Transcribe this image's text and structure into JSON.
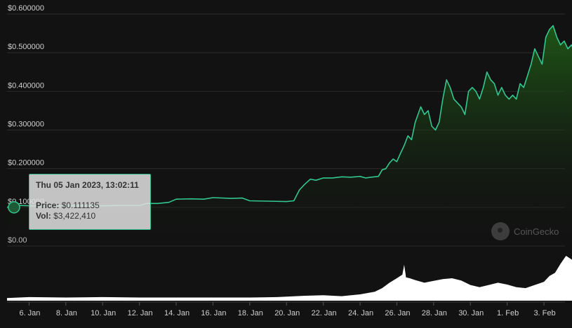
{
  "chart_data": {
    "type": "area",
    "y_ticks": [
      "$0.600000",
      "$0.500000",
      "$0.400000",
      "$0.300000",
      "$0.200000",
      "$0.100000",
      "$0.00"
    ],
    "x_ticks": [
      "6. Jan",
      "8. Jan",
      "10. Jan",
      "12. Jan",
      "14. Jan",
      "16. Jan",
      "18. Jan",
      "20. Jan",
      "22. Jan",
      "24. Jan",
      "26. Jan",
      "28. Jan",
      "30. Jan",
      "1. Feb",
      "3. Feb"
    ],
    "ylim": [
      0,
      0.6
    ],
    "xlim": [
      4.8,
      36.7
    ],
    "grid": "horizontal",
    "price_series": {
      "x": [
        4.8,
        5.4,
        6.0,
        7.0,
        8.0,
        9.0,
        10.0,
        11.0,
        12.0,
        12.4,
        13.0,
        13.6,
        14.0,
        14.8,
        15.5,
        16.0,
        17.0,
        17.6,
        18.0,
        19.0,
        20.0,
        20.4,
        20.7,
        21.0,
        21.3,
        21.6,
        22.0,
        22.5,
        23.0,
        23.5,
        24.0,
        24.3,
        24.6,
        25.0,
        25.2,
        25.4,
        25.6,
        25.8,
        26.0,
        26.2,
        26.4,
        26.6,
        26.8,
        27.0,
        27.3,
        27.5,
        27.7,
        27.9,
        28.1,
        28.3,
        28.5,
        28.7,
        28.9,
        29.1,
        29.3,
        29.5,
        29.7,
        29.9,
        30.1,
        30.3,
        30.5,
        30.7,
        30.9,
        31.1,
        31.3,
        31.5,
        31.7,
        31.9,
        32.1,
        32.3,
        32.5,
        32.7,
        32.9,
        33.1,
        33.3,
        33.5,
        33.7,
        33.9,
        34.1,
        34.3,
        34.5,
        34.7,
        34.9,
        35.1,
        35.3,
        35.5,
        35.7,
        35.9,
        36.1,
        36.3,
        36.5,
        36.7
      ],
      "y": [
        0.1,
        0.105,
        0.104,
        0.103,
        0.104,
        0.104,
        0.104,
        0.105,
        0.105,
        0.11,
        0.11,
        0.113,
        0.121,
        0.122,
        0.121,
        0.125,
        0.123,
        0.124,
        0.117,
        0.116,
        0.115,
        0.117,
        0.145,
        0.16,
        0.173,
        0.17,
        0.176,
        0.176,
        0.179,
        0.178,
        0.18,
        0.176,
        0.178,
        0.18,
        0.197,
        0.2,
        0.215,
        0.225,
        0.218,
        0.24,
        0.26,
        0.285,
        0.275,
        0.32,
        0.36,
        0.34,
        0.35,
        0.31,
        0.3,
        0.32,
        0.38,
        0.43,
        0.41,
        0.38,
        0.37,
        0.36,
        0.34,
        0.4,
        0.41,
        0.4,
        0.38,
        0.41,
        0.45,
        0.43,
        0.42,
        0.39,
        0.41,
        0.39,
        0.38,
        0.39,
        0.38,
        0.42,
        0.41,
        0.44,
        0.47,
        0.51,
        0.49,
        0.47,
        0.54,
        0.56,
        0.57,
        0.54,
        0.52,
        0.53,
        0.51,
        0.52,
        0.5,
        0.47,
        0.51,
        0.5,
        0.52,
        0.56
      ]
    },
    "volume_series": {
      "x": [
        4.8,
        6.0,
        8.0,
        10.0,
        12.0,
        14.0,
        16.0,
        18.0,
        19.5,
        20.5,
        21.0,
        22.0,
        23.0,
        24.0,
        24.8,
        25.2,
        25.6,
        26.0,
        26.3,
        26.4,
        26.5,
        26.7,
        27.0,
        27.5,
        28.0,
        28.5,
        29.0,
        29.5,
        30.0,
        30.5,
        31.0,
        31.5,
        32.0,
        32.5,
        33.0,
        33.5,
        34.0,
        34.3,
        34.6,
        34.9,
        35.2,
        35.5,
        35.8,
        36.1,
        36.4,
        36.7
      ],
      "y": [
        0.06,
        0.08,
        0.07,
        0.08,
        0.07,
        0.07,
        0.07,
        0.07,
        0.08,
        0.1,
        0.11,
        0.12,
        0.1,
        0.14,
        0.2,
        0.28,
        0.4,
        0.5,
        0.58,
        0.8,
        0.52,
        0.5,
        0.46,
        0.4,
        0.44,
        0.48,
        0.5,
        0.45,
        0.35,
        0.3,
        0.35,
        0.4,
        0.36,
        0.3,
        0.28,
        0.35,
        0.42,
        0.55,
        0.62,
        0.82,
        1.0,
        0.92,
        0.85,
        0.62,
        0.6,
        0.58
      ]
    },
    "colors": {
      "line": "#33c690",
      "fill_top": "#1c4a16",
      "volume": "#ffffff",
      "grid": "#2c2c2c",
      "text": "#d0d0d0"
    }
  },
  "tooltip": {
    "title": "Thu 05 Jan 2023, 13:02:11",
    "price_label": "Price:",
    "price_value": "$0.111135",
    "vol_label": "Vol:",
    "vol_value": "$3,422,410"
  },
  "watermark": {
    "text": "CoinGecko"
  }
}
